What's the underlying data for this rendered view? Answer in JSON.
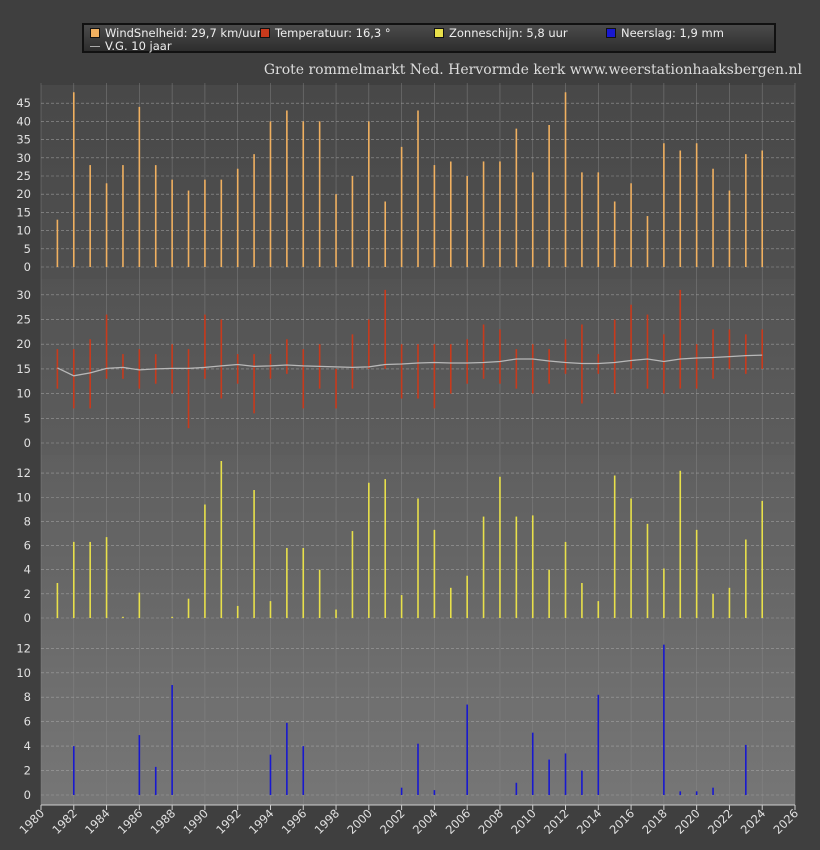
{
  "colors": {
    "wind": "#f0b060",
    "temp": "#c83a1c",
    "sun": "#e8e04a",
    "rain": "#1818d0",
    "avg": "#b8b8b8"
  },
  "legend": {
    "wind": "WindSnelheid: 29,7 km/uur",
    "temp": "Temperatuur: 16,3 °",
    "sun": "Zonneschijn: 5,8 uur",
    "rain": "Neerslag: 1,9 mm",
    "avg": "V.G. 10 jaar"
  },
  "subtitle": "Grote rommelmarkt Ned. Hervormde kerk  www.weerstationhaaksbergen.nl",
  "chart_data": [
    {
      "type": "bar",
      "ylim": [
        0,
        50
      ],
      "yticks": [
        0,
        5,
        10,
        15,
        20,
        25,
        30,
        35,
        40,
        45
      ],
      "xlim": [
        1980,
        2026
      ],
      "xticks": [
        1980,
        1982,
        1984,
        1986,
        1988,
        1990,
        1992,
        1994,
        1996,
        1998,
        2000,
        2002,
        2004,
        2006,
        2008,
        2010,
        2012,
        2014,
        2016,
        2018,
        2020,
        2022,
        2024,
        2026
      ],
      "series": [
        {
          "name": "WindSnelheid",
          "x": [
            1981,
            1982,
            1983,
            1984,
            1985,
            1986,
            1987,
            1988,
            1989,
            1990,
            1991,
            1992,
            1993,
            1994,
            1995,
            1996,
            1997,
            1998,
            1999,
            2000,
            2001,
            2002,
            2003,
            2004,
            2005,
            2006,
            2007,
            2008,
            2009,
            2010,
            2011,
            2012,
            2013,
            2014,
            2015,
            2016,
            2017,
            2018,
            2019,
            2020,
            2021,
            2022,
            2023,
            2024
          ],
          "values": [
            13,
            48,
            28,
            23,
            28,
            44,
            28,
            24,
            21,
            24,
            24,
            27,
            31,
            40,
            43,
            40,
            40,
            20,
            25,
            40,
            18,
            33,
            43,
            28,
            29,
            25,
            29,
            29,
            38,
            26,
            39,
            48,
            26,
            26,
            18,
            23,
            14,
            34,
            32,
            34,
            27,
            21,
            31,
            32
          ]
        }
      ]
    },
    {
      "type": "bar",
      "ylim": [
        -2,
        33
      ],
      "yticks": [
        0,
        5,
        10,
        15,
        20,
        25,
        30
      ],
      "series": [
        {
          "name": "Temperatuur",
          "x": [
            1981,
            1982,
            1983,
            1984,
            1985,
            1986,
            1987,
            1988,
            1989,
            1990,
            1991,
            1992,
            1993,
            1994,
            1995,
            1996,
            1997,
            1998,
            1999,
            2000,
            2001,
            2002,
            2003,
            2004,
            2005,
            2006,
            2007,
            2008,
            2009,
            2010,
            2011,
            2012,
            2013,
            2014,
            2015,
            2016,
            2017,
            2018,
            2019,
            2020,
            2021,
            2022,
            2023,
            2024
          ],
          "low": [
            11,
            7,
            7,
            13,
            13,
            11,
            12,
            10,
            3,
            13,
            9,
            12,
            6,
            13,
            14,
            7,
            11,
            7,
            11,
            15,
            15,
            9,
            9,
            7,
            10,
            12,
            13,
            12,
            11,
            10,
            12,
            14,
            8,
            14,
            10,
            15,
            11,
            10,
            11,
            11,
            13,
            15,
            14,
            15
          ],
          "high": [
            19,
            19,
            21,
            26,
            18,
            19,
            18,
            20,
            19,
            26,
            25,
            18,
            18,
            18,
            21,
            19,
            20,
            15,
            22,
            25,
            31,
            20,
            20,
            20,
            20,
            21,
            24,
            23,
            19,
            20,
            19,
            21,
            24,
            18,
            25,
            28,
            26,
            22,
            31,
            20,
            23,
            23,
            22,
            23
          ]
        },
        {
          "name": "V.G. 10 jaar",
          "type": "line",
          "x": [
            1981,
            1982,
            1983,
            1984,
            1985,
            1986,
            1987,
            1988,
            1989,
            1990,
            1991,
            1992,
            1993,
            1994,
            1995,
            1996,
            1997,
            1998,
            1999,
            2000,
            2001,
            2002,
            2003,
            2004,
            2005,
            2006,
            2007,
            2008,
            2009,
            2010,
            2011,
            2012,
            2013,
            2014,
            2015,
            2016,
            2017,
            2018,
            2019,
            2020,
            2021,
            2022,
            2023,
            2024
          ],
          "values": [
            15.2,
            13.6,
            14.2,
            15.1,
            15.3,
            14.8,
            15.0,
            15.1,
            15.1,
            15.3,
            15.6,
            15.9,
            15.5,
            15.6,
            15.8,
            15.6,
            15.5,
            15.4,
            15.3,
            15.4,
            15.9,
            16.0,
            16.2,
            16.3,
            16.2,
            16.2,
            16.3,
            16.5,
            17.0,
            17.0,
            16.6,
            16.3,
            16.1,
            16.1,
            16.3,
            16.7,
            17.0,
            16.5,
            17.0,
            17.2,
            17.3,
            17.5,
            17.7,
            17.8
          ]
        }
      ]
    },
    {
      "type": "bar",
      "ylim": [
        0,
        13.5
      ],
      "yticks": [
        0,
        2,
        4,
        6,
        8,
        10,
        12
      ],
      "series": [
        {
          "name": "Zonneschijn",
          "x": [
            1981,
            1982,
            1983,
            1984,
            1985,
            1986,
            1988,
            1989,
            1990,
            1991,
            1992,
            1993,
            1994,
            1995,
            1996,
            1997,
            1998,
            1999,
            2000,
            2001,
            2002,
            2003,
            2004,
            2005,
            2006,
            2007,
            2008,
            2009,
            2010,
            2011,
            2012,
            2013,
            2014,
            2015,
            2016,
            2017,
            2018,
            2019,
            2020,
            2021,
            2022,
            2023,
            2024
          ],
          "values": [
            2.9,
            6.3,
            6.3,
            6.7,
            0.1,
            2.1,
            0.1,
            1.6,
            9.4,
            13.0,
            1.0,
            10.6,
            1.4,
            5.8,
            5.8,
            4.0,
            0.7,
            7.2,
            11.2,
            11.5,
            1.9,
            9.9,
            7.3,
            2.5,
            3.5,
            8.4,
            11.7,
            8.4,
            8.5,
            4.0,
            6.3,
            2.9,
            1.4,
            11.8,
            9.9,
            7.8,
            4.1,
            12.2,
            7.3,
            2.0,
            2.5,
            6.5,
            9.7
          ]
        }
      ]
    },
    {
      "type": "bar",
      "ylim": [
        0,
        13.5
      ],
      "yticks": [
        0,
        2,
        4,
        6,
        8,
        10,
        12
      ],
      "series": [
        {
          "name": "Neerslag",
          "x": [
            1982,
            1986,
            1987,
            1988,
            1994,
            1995,
            1996,
            2002,
            2003,
            2004,
            2006,
            2009,
            2010,
            2011,
            2012,
            2013,
            2014,
            2018,
            2019,
            2020,
            2021,
            2023
          ],
          "values": [
            4.0,
            4.9,
            2.3,
            9.0,
            3.3,
            5.9,
            4.0,
            0.6,
            4.2,
            0.4,
            7.4,
            1.0,
            5.1,
            2.9,
            3.4,
            2.0,
            8.2,
            12.3,
            0.3,
            0.3,
            0.6,
            4.1
          ]
        }
      ]
    }
  ]
}
